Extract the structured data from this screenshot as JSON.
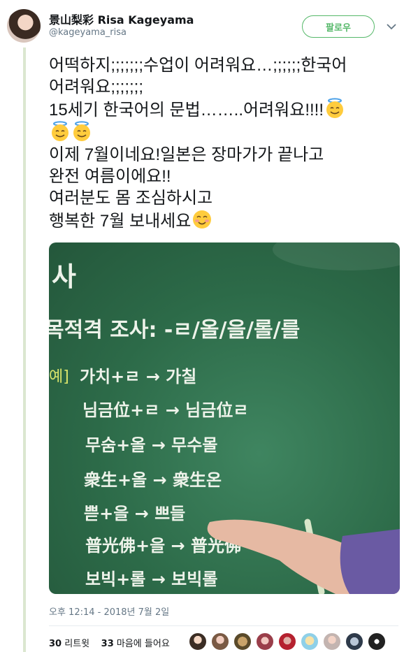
{
  "user": {
    "display_name": "景山梨彩 Risa Kageyama",
    "handle": "@kageyama_risa",
    "follow_label": "팔로우"
  },
  "tweet": {
    "lines": [
      "어떡하지;;;;;;;수업이 어려워요…;;;;;;한국어",
      "어려워요;;;;;;;",
      "15세기 한국어의 문법……..어려워요!!!!",
      "",
      "이제 7월이네요!일본은 장마가가 끝나고",
      "완전 여름이에요!!",
      "여러분도 몸 조심하시고",
      "행복한 7월 보내세요"
    ],
    "emoji": {
      "halo": "smiling-face-with-halo",
      "blush": "smiling-face-with-smiling-eyes"
    }
  },
  "photo": {
    "heading_fragment": "사",
    "subtitle": "목적격 조사: -ㄹ/올/을/롤/를",
    "example_marker": "예]",
    "rows": [
      "가치+ㄹ → 가칠",
      "님금位+ㄹ → 님금位ㄹ",
      "무숨+올 → 무수몰",
      "衆生+올 → 衆生온",
      "쁟+을 → 쁘들",
      "普光佛+을 → 普光佛",
      "보빅+롤 → 보빅롤"
    ]
  },
  "meta": {
    "timestamp": "오후 12:14 - 2018년 7월 2일"
  },
  "stats": {
    "retweets_count": "30",
    "retweets_label": "리트윗",
    "likes_count": "33",
    "likes_label": "마음에 들어요"
  },
  "colors": {
    "accent": "#55b869",
    "thread_line": "#dbe7d0",
    "muted": "#657786",
    "board": "#2c6a48"
  },
  "likers": [
    "liker-avatar-1",
    "liker-avatar-2",
    "liker-avatar-3",
    "liker-avatar-4",
    "liker-avatar-5",
    "liker-avatar-6",
    "liker-avatar-7",
    "liker-avatar-8",
    "liker-avatar-9"
  ]
}
